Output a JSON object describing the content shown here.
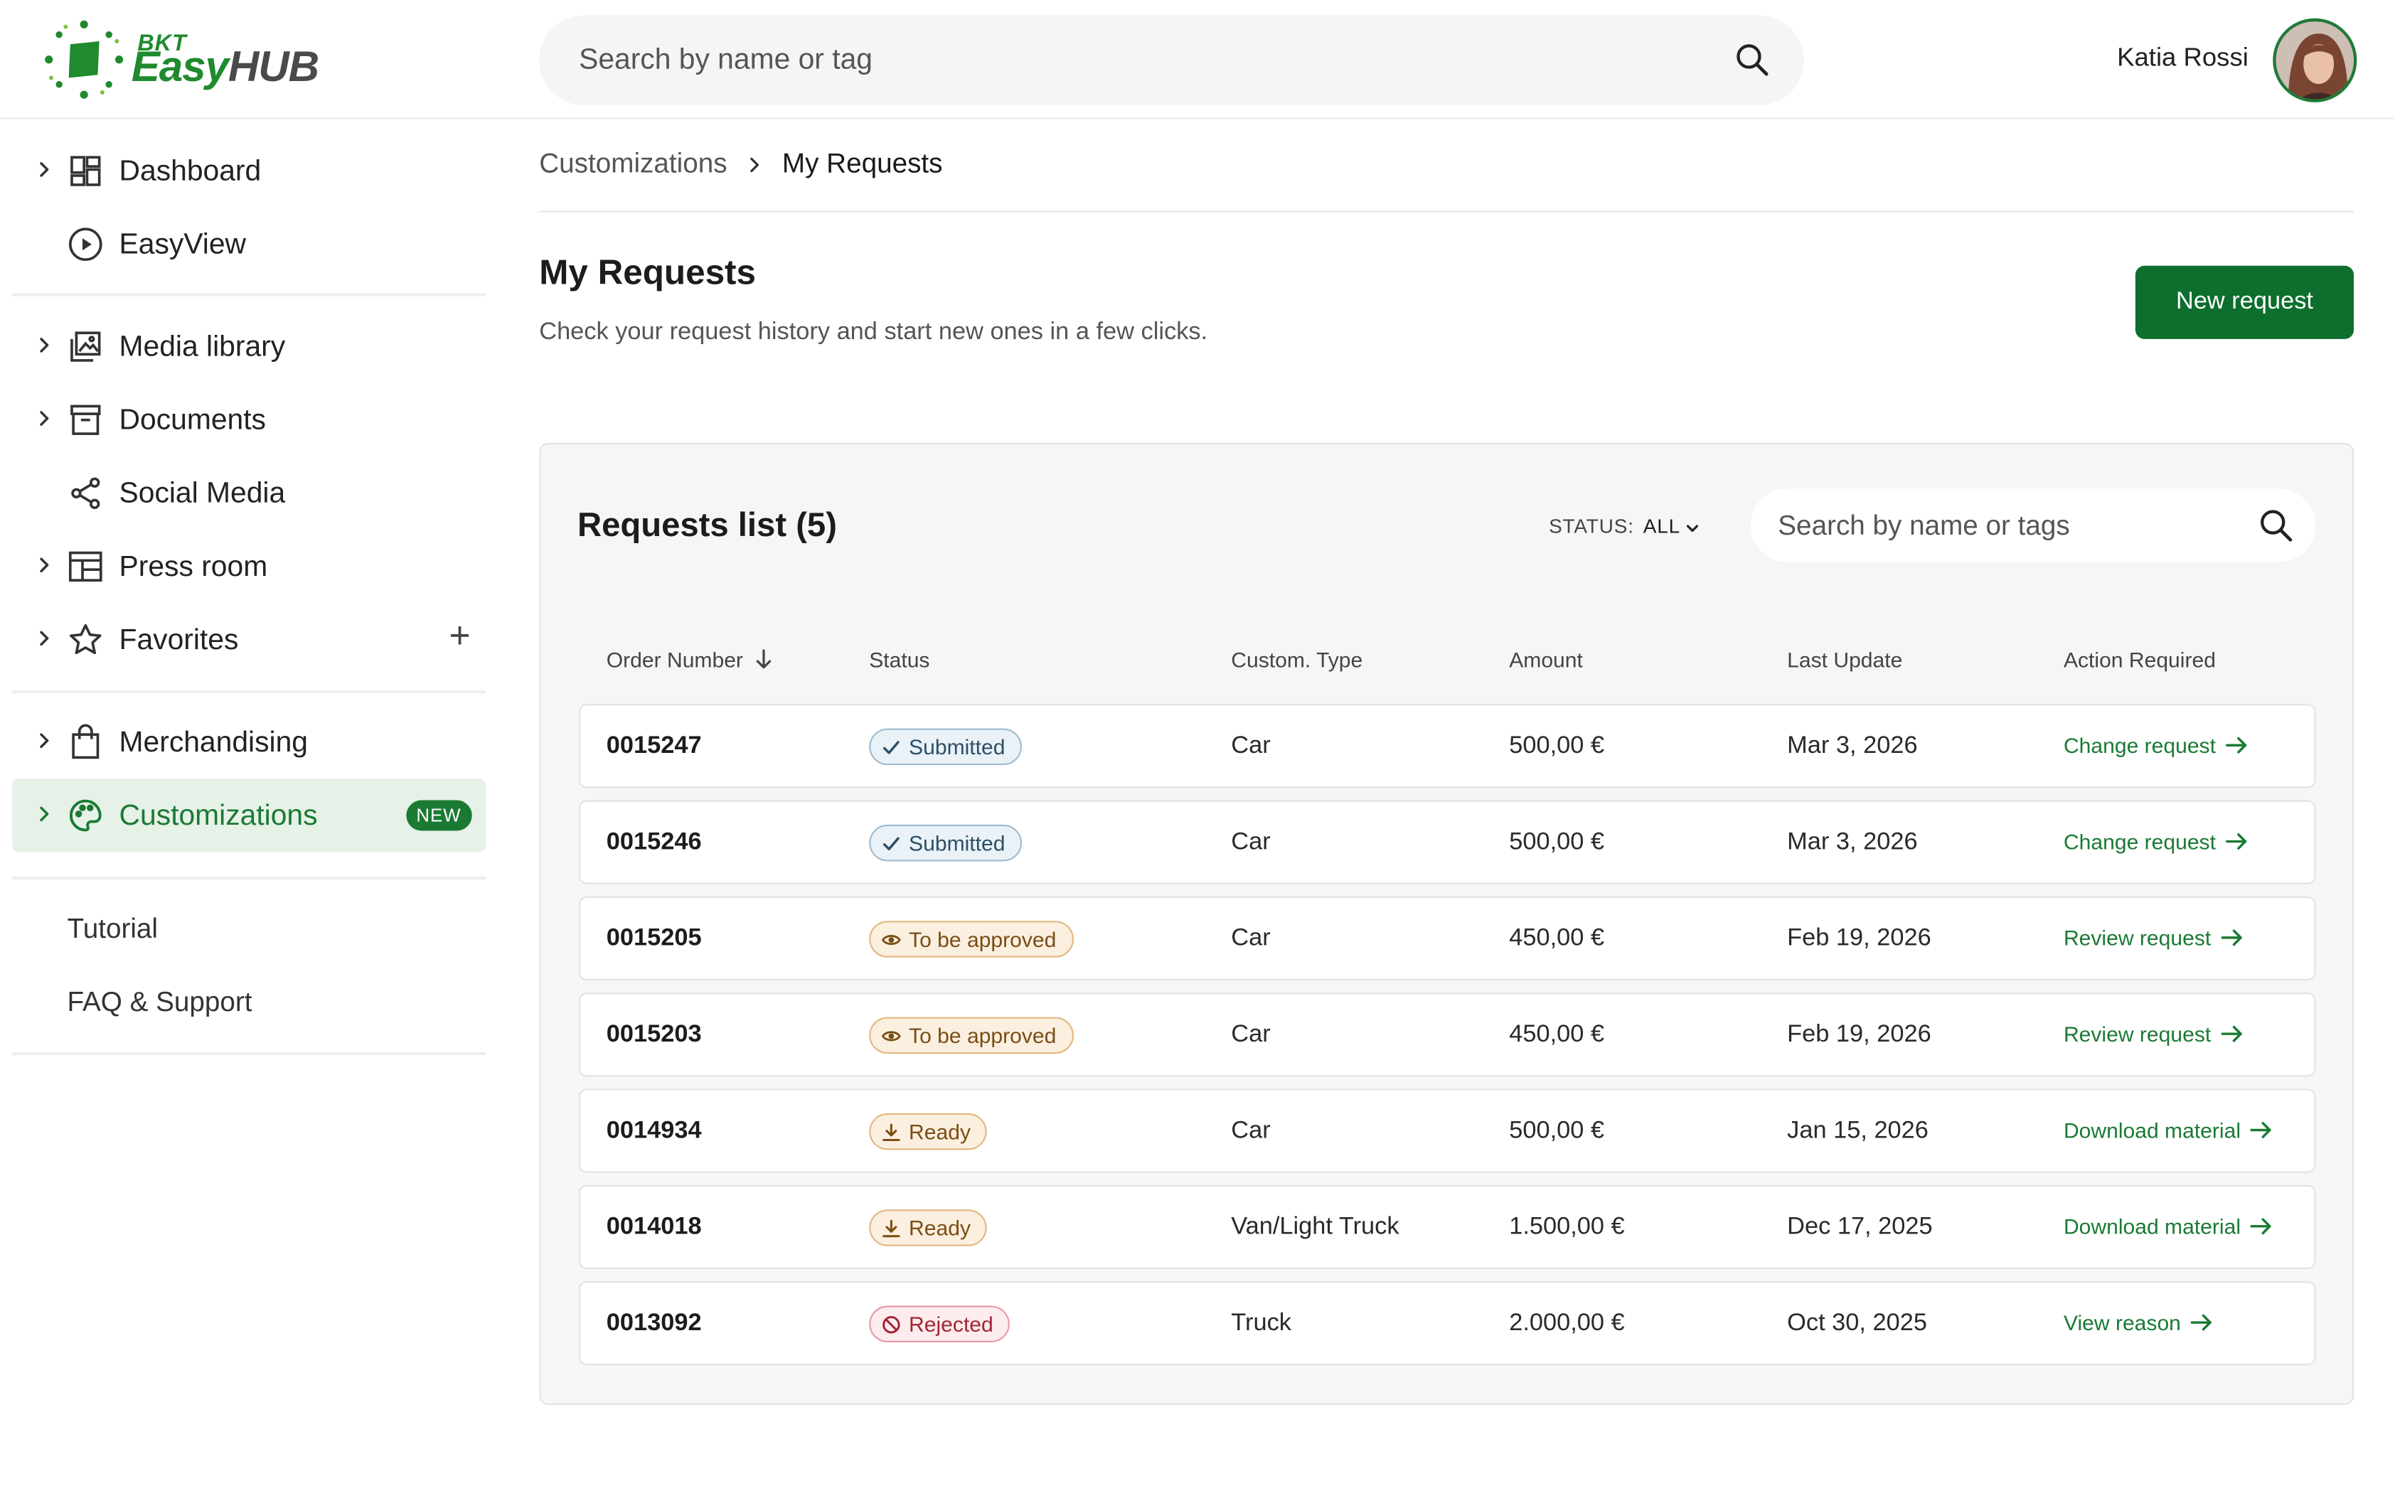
{
  "header": {
    "logo": {
      "brand_small": "BKT",
      "brand_easy": "Easy",
      "brand_hub": "HUB"
    },
    "search_placeholder": "Search by name or tag",
    "user_name": "Katia Rossi"
  },
  "sidebar": {
    "items": [
      {
        "label": "Dashboard",
        "icon": "dashboard-icon",
        "expandable": true
      },
      {
        "label": "EasyView",
        "icon": "play-circle-icon",
        "expandable": false
      },
      {
        "label": "Media library",
        "icon": "media-library-icon",
        "expandable": true
      },
      {
        "label": "Documents",
        "icon": "archive-box-icon",
        "expandable": true
      },
      {
        "label": "Social Media",
        "icon": "share-icon",
        "expandable": false
      },
      {
        "label": "Press room",
        "icon": "press-layout-icon",
        "expandable": true
      },
      {
        "label": "Favorites",
        "icon": "star-icon",
        "expandable": true,
        "action": "+"
      },
      {
        "label": "Merchandising",
        "icon": "shopping-bag-icon",
        "expandable": true
      },
      {
        "label": "Customizations",
        "icon": "palette-icon",
        "expandable": true,
        "active": true,
        "badge": "NEW"
      }
    ],
    "links": [
      "Tutorial",
      "FAQ & Support"
    ]
  },
  "breadcrumb": {
    "parent": "Customizations",
    "current": "My Requests"
  },
  "page": {
    "title": "My Requests",
    "subtitle": "Check your request history and start new ones in a few clicks.",
    "new_request_label": "New request"
  },
  "requests": {
    "title": "Requests list (5)",
    "status_label": "STATUS:",
    "status_value": "ALL",
    "search_placeholder": "Search by name or tags",
    "columns": [
      "Order Number",
      "Status",
      "Custom. Type",
      "Amount",
      "Last Update",
      "Action Required"
    ],
    "rows": [
      {
        "order": "0015247",
        "status": "Submitted",
        "status_kind": "submitted",
        "type": "Car",
        "amount": "500,00 €",
        "date": "Mar 3, 2026",
        "action": "Change request"
      },
      {
        "order": "0015246",
        "status": "Submitted",
        "status_kind": "submitted",
        "type": "Car",
        "amount": "500,00 €",
        "date": "Mar 3, 2026",
        "action": "Change request"
      },
      {
        "order": "0015205",
        "status": "To be approved",
        "status_kind": "approve",
        "type": "Car",
        "amount": "450,00 €",
        "date": "Feb 19, 2026",
        "action": "Review request"
      },
      {
        "order": "0015203",
        "status": "To be approved",
        "status_kind": "approve",
        "type": "Car",
        "amount": "450,00 €",
        "date": "Feb 19, 2026",
        "action": "Review request"
      },
      {
        "order": "0014934",
        "status": "Ready",
        "status_kind": "ready",
        "type": "Car",
        "amount": "500,00 €",
        "date": "Jan 15, 2026",
        "action": "Download material"
      },
      {
        "order": "0014018",
        "status": "Ready",
        "status_kind": "ready",
        "type": "Van/Light Truck",
        "amount": "1.500,00 €",
        "date": "Dec 17, 2025",
        "action": "Download material"
      },
      {
        "order": "0013092",
        "status": "Rejected",
        "status_kind": "rejected",
        "type": "Truck",
        "amount": "2.000,00 €",
        "date": "Oct 30, 2025",
        "action": "View reason"
      }
    ]
  },
  "colors": {
    "brand_green": "#1a7a33",
    "button_green": "#0e6e2d",
    "active_bg": "#e6f1e8",
    "submitted": "#2c4f66",
    "approve": "#7a4d14",
    "rejected": "#a12534"
  }
}
